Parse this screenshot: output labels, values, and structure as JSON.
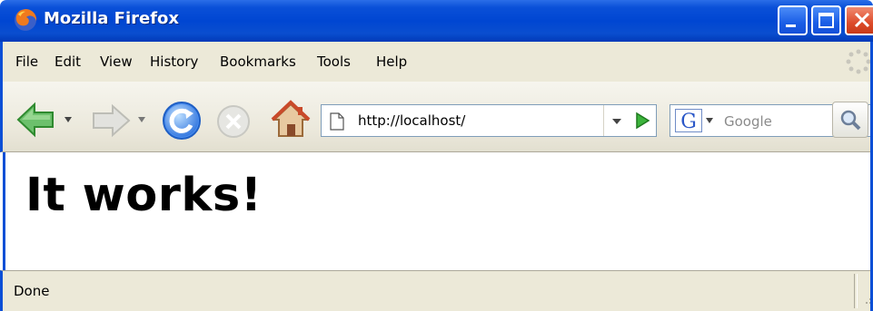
{
  "window": {
    "title": "Mozilla Firefox",
    "icon": "firefox-icon",
    "controls": [
      "minimize-icon",
      "maximize-icon",
      "close-icon"
    ]
  },
  "menu": {
    "items": [
      {
        "label": "File"
      },
      {
        "label": "Edit"
      },
      {
        "label": "View"
      },
      {
        "label": "History"
      },
      {
        "label": "Bookmarks"
      },
      {
        "label": "Tools"
      },
      {
        "label": "Help"
      }
    ]
  },
  "toolbar": {
    "buttons": [
      "back-icon",
      "forward-icon",
      "reload-icon",
      "stop-icon",
      "home-icon"
    ],
    "url": "http://localhost/",
    "search_engine": "Google",
    "search_placeholder": "Google"
  },
  "page": {
    "heading": "It works!"
  },
  "status": {
    "text": "Done"
  },
  "colors": {
    "title_bar": "#0046d2",
    "chrome": "#ece9d8",
    "go_arrow": "#2aa02a",
    "back_arrow": "#4fb84f"
  }
}
